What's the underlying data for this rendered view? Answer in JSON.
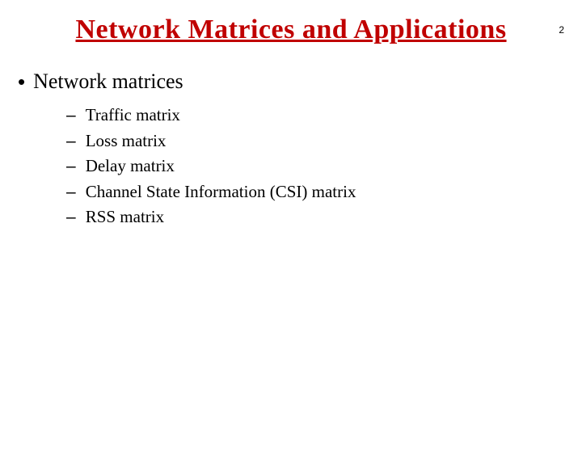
{
  "pageNumber": "2",
  "title": "Network Matrices and Applications",
  "bullets": {
    "main": "Network matrices",
    "subs": [
      "Traffic matrix",
      "Loss matrix",
      "Delay matrix",
      "Channel State Information (CSI) matrix",
      "RSS matrix"
    ]
  }
}
